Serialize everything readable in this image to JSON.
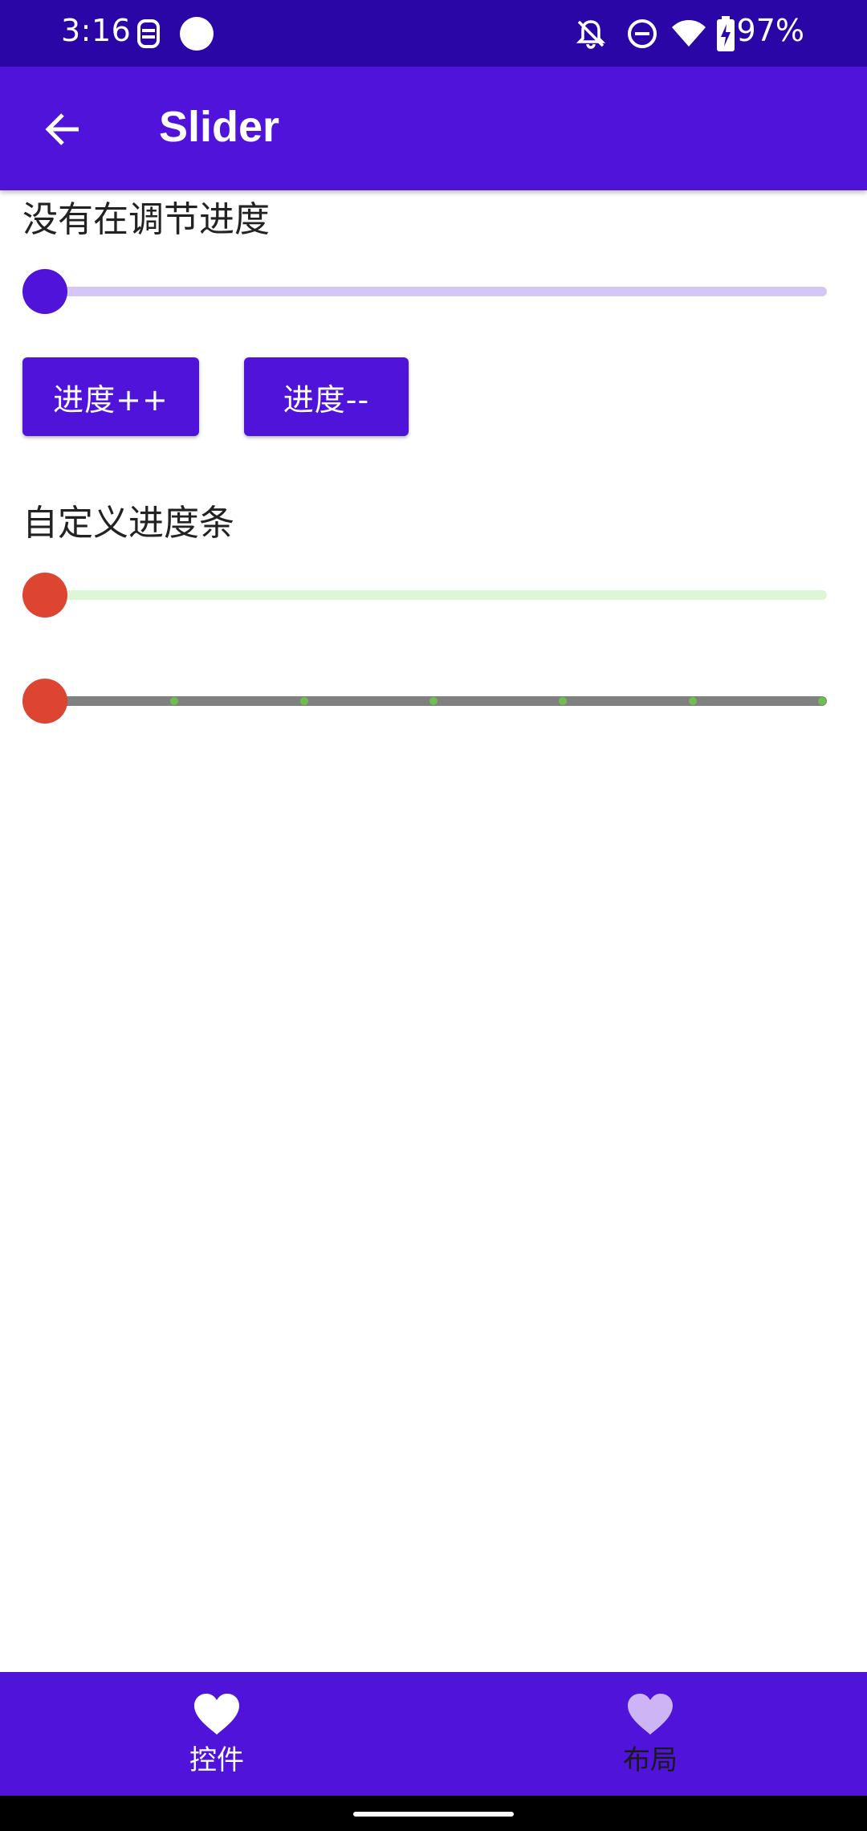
{
  "status_bar": {
    "time": "3:16",
    "battery_text": "97%",
    "icons": [
      "app-notification-icon",
      "circle-dot-icon",
      "notifications-off-icon",
      "do-not-disturb-icon",
      "wifi-icon",
      "battery-charging-icon"
    ]
  },
  "app_bar": {
    "title": "Slider",
    "back_icon": "arrow-back-icon"
  },
  "main": {
    "status_label": "没有在调节进度",
    "slider1": {
      "value": 0,
      "track_color": "#D4C7F5",
      "thumb_color": "#5013DA"
    },
    "increase_button": "进度++",
    "decrease_button": "进度--",
    "custom_label": "自定义进度条",
    "slider2": {
      "value": 0,
      "track_color": "#DDF7D6",
      "thumb_color": "#DD4432"
    },
    "slider3": {
      "value": 0,
      "steps": 6,
      "track_color": "#808080",
      "tick_color": "#6FBF4E",
      "thumb_color": "#DD4432"
    }
  },
  "bottom_nav": {
    "items": [
      {
        "label": "控件",
        "icon": "heart-icon",
        "selected": true
      },
      {
        "label": "布局",
        "icon": "heart-icon",
        "selected": false
      }
    ]
  },
  "colors": {
    "status_bar": "#2A06A6",
    "primary": "#5013DA",
    "nav_unselected": "#CDB5F5"
  }
}
